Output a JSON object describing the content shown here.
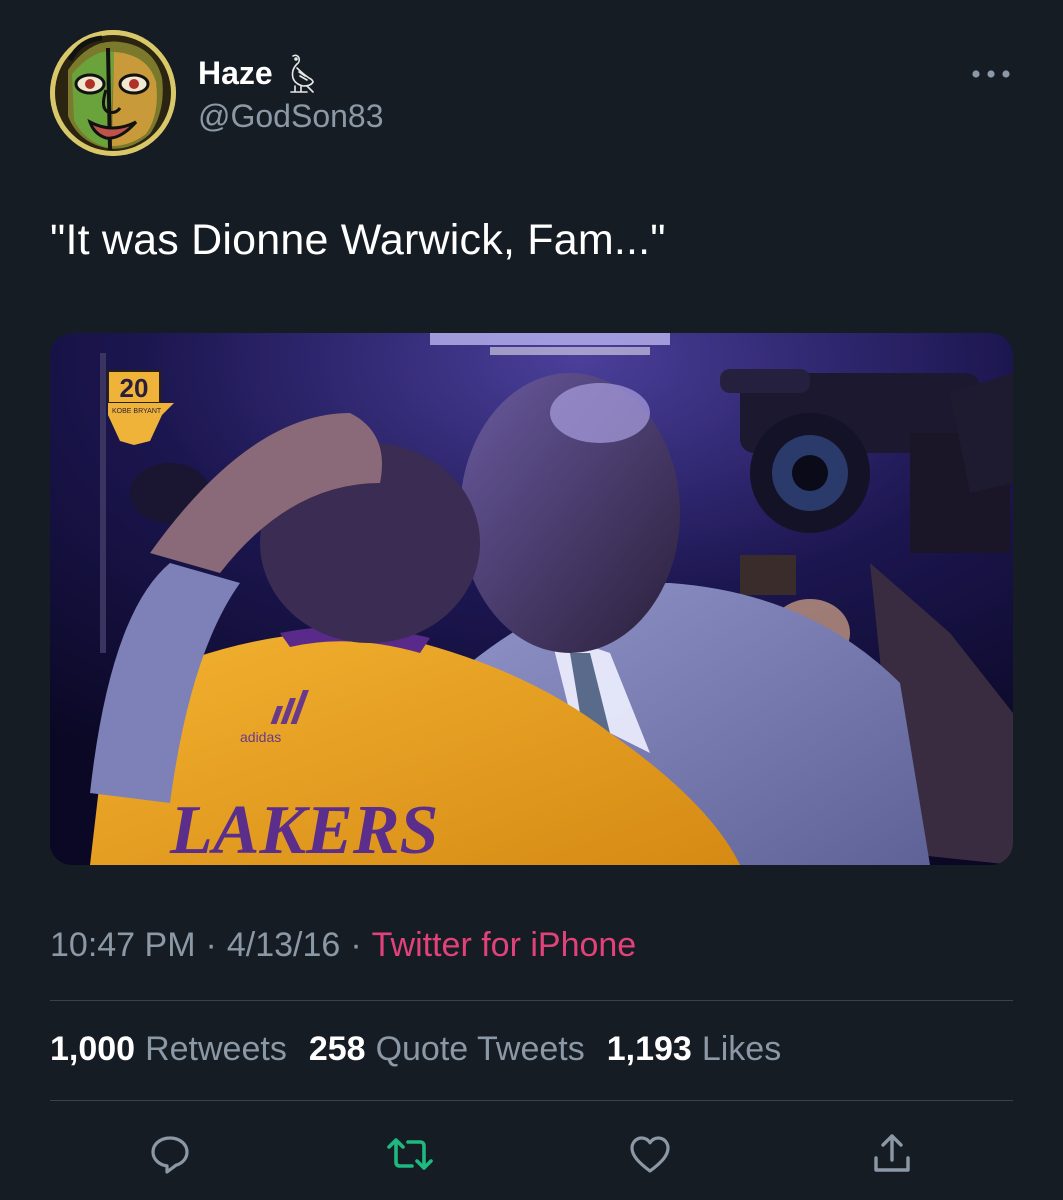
{
  "author": {
    "display_name": "Haze",
    "handle": "@GodSon83",
    "badge_icon": "owl-icon"
  },
  "tweet": {
    "text": "\"It was Dionne Warwick, Fam...\""
  },
  "media": {
    "jersey_badge_number": "20",
    "jersey_badge_text": "KOBE BRYANT",
    "jersey_text": "LAKERS",
    "brand_text": "adidas"
  },
  "meta": {
    "time": "10:47 PM",
    "separator": "·",
    "date": "4/13/16",
    "source": "Twitter for iPhone"
  },
  "stats": {
    "retweets_count": "1,000",
    "retweets_label": "Retweets",
    "quotes_count": "258",
    "quotes_label": "Quote Tweets",
    "likes_count": "1,193",
    "likes_label": "Likes"
  },
  "actions": [
    "reply-icon",
    "retweet-icon",
    "like-icon",
    "share-icon"
  ],
  "colors": {
    "background": "#161c24",
    "secondary_text": "#8b98a5",
    "source_link": "#e2427a",
    "retweet_icon": "#1fb87f",
    "divider": "#38444d"
  }
}
